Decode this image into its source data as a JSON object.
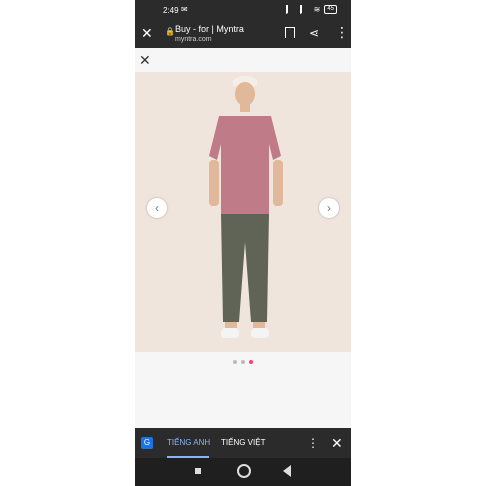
{
  "status": {
    "time": "2:49",
    "battery": "45"
  },
  "browser": {
    "title": "Buy - for | Myntra",
    "domain": "myntra.com"
  },
  "gallery": {
    "prev_icon": "chevron-left-icon",
    "next_icon": "chevron-right-icon",
    "dots_total": 3,
    "active_dot": 3
  },
  "translate_bar": {
    "tab_source": "TIẾNG ANH",
    "tab_target": "TIẾNG VIỆT"
  },
  "colors": {
    "background": "#2b2b2b",
    "accent": "#ff3f6c",
    "translate_active": "#8ab4f8"
  }
}
